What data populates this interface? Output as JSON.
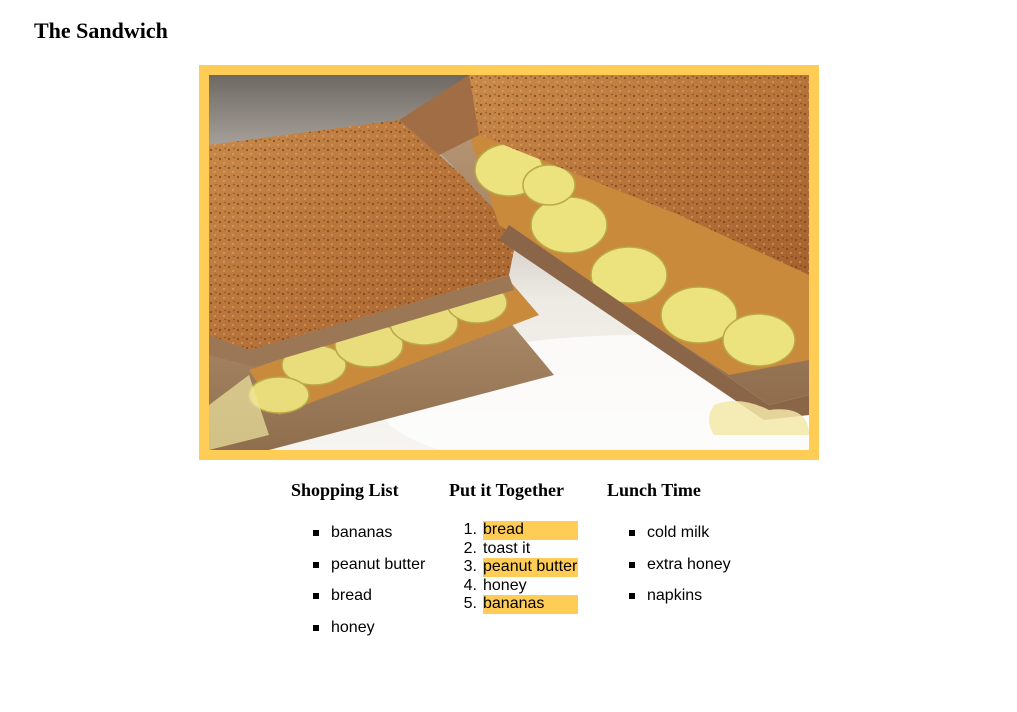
{
  "page": {
    "title": "The Sandwich"
  },
  "photo": {
    "subject": "toasted peanut butter and banana sandwich",
    "frame_color": "#ffcc55"
  },
  "shopping": {
    "heading": "Shopping List",
    "items": [
      "bananas",
      "peanut butter",
      "bread",
      "honey"
    ]
  },
  "steps": {
    "heading": "Put it Together",
    "items": [
      {
        "num": "1.",
        "text": "bread",
        "highlight": true
      },
      {
        "num": "2.",
        "text": "toast it",
        "highlight": false
      },
      {
        "num": "3.",
        "text": "peanut butter",
        "highlight": true
      },
      {
        "num": "4.",
        "text": "honey",
        "highlight": false
      },
      {
        "num": "5.",
        "text": "bananas",
        "highlight": true
      }
    ],
    "highlight_color": "#ffcc55"
  },
  "lunch": {
    "heading": "Lunch Time",
    "items": [
      "cold milk",
      "extra honey",
      "napkins"
    ]
  }
}
